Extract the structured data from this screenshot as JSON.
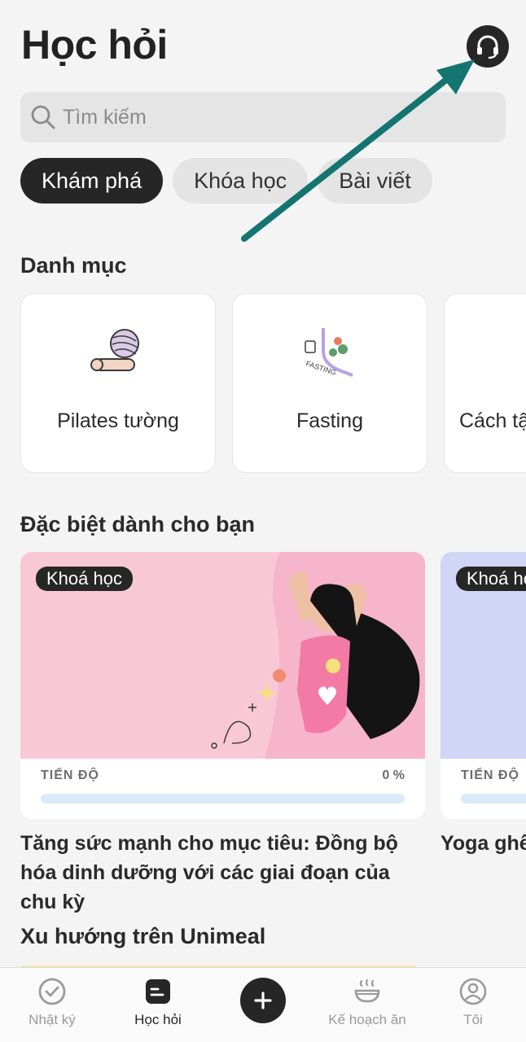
{
  "header": {
    "title": "Học hỏi"
  },
  "search": {
    "placeholder": "Tìm kiếm"
  },
  "tabs": [
    {
      "label": "Khám phá",
      "active": true
    },
    {
      "label": "Khóa học",
      "active": false
    },
    {
      "label": "Bài viết",
      "active": false
    }
  ],
  "categories": {
    "title": "Danh mục",
    "items": [
      {
        "label": "Pilates tường",
        "icon": "pilates-ball-mat-icon"
      },
      {
        "label": "Fasting",
        "icon": "fasting-plate-icon",
        "ill_text": "FASTING"
      },
      {
        "label": "Cách tậ",
        "icon": "category-illustration-icon"
      }
    ]
  },
  "featured": {
    "title": "Đặc biệt dành cho bạn",
    "progress_label": "TIẾN ĐỘ",
    "courses": [
      {
        "badge": "Khoá học",
        "progress_text": "0 %",
        "progress": 0,
        "title": "Tăng sức mạnh cho mục tiêu: Đồng bộ hóa dinh dưỡng với các giai đoạn của chu kỳ",
        "banner_color": "#f9c8d6"
      },
      {
        "badge": "Khoá họ",
        "progress_text": "",
        "progress": 0,
        "title": "Yoga ghế",
        "banner_color": "#cfd6f6"
      }
    ]
  },
  "trending": {
    "title": "Xu hướng trên Unimeal"
  },
  "bottom_nav": [
    {
      "label": "Nhật ký",
      "icon": "check-circle-icon",
      "active": false
    },
    {
      "label": "Học hỏi",
      "icon": "learn-icon",
      "active": true
    },
    {
      "label": "",
      "icon": "plus-icon",
      "active": false
    },
    {
      "label": "Kế hoạch ăn",
      "icon": "meal-bowl-icon",
      "active": false
    },
    {
      "label": "Tôi",
      "icon": "profile-icon",
      "active": false
    }
  ],
  "colors": {
    "accent_dark": "#262626",
    "arrow": "#147470",
    "progress_track": "#d9ebf8"
  }
}
